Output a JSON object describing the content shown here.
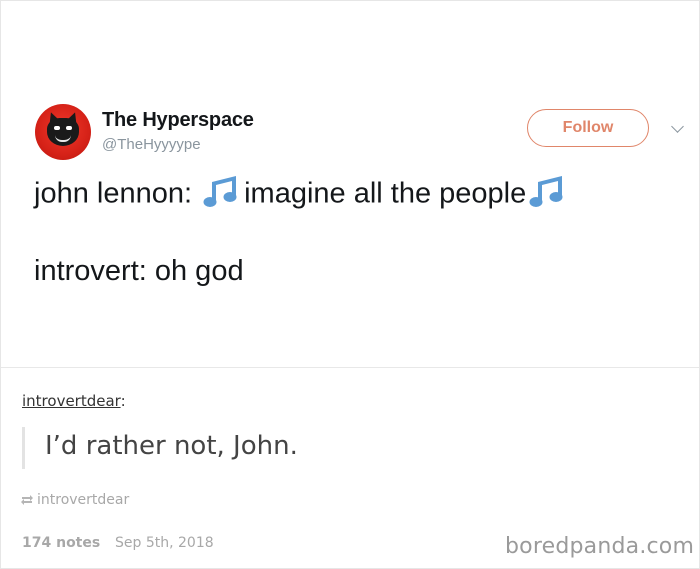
{
  "tweet": {
    "display_name": "The Hyperspace",
    "handle": "@TheHyyyype",
    "follow_label": "Follow",
    "line1_a": "john lennon: ",
    "line1_b": "imagine all the people",
    "line2": "introvert: oh god",
    "note_icon": "musical-notes-emoji",
    "accent_color": "#e0866a",
    "note_color": "#5b9bd5"
  },
  "reblog": {
    "username": "introvertdear",
    "colon": ":",
    "quote": "I’d rather not, John.",
    "source_username": "introvertdear",
    "notes": "174 notes",
    "date": "Sep 5th, 2018"
  },
  "watermark": "boredpanda.com"
}
